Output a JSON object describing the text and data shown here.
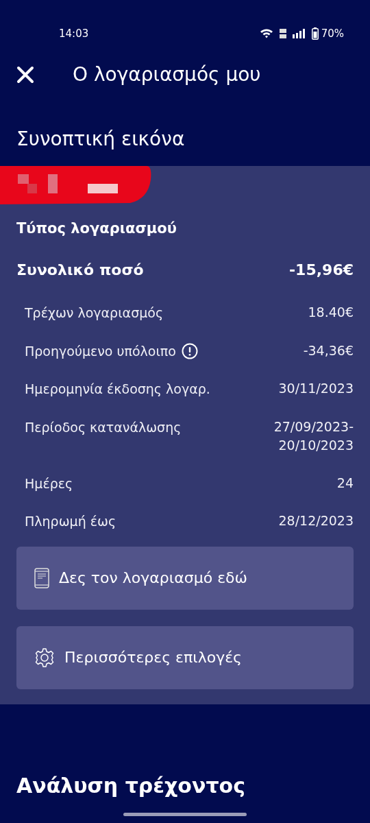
{
  "status_bar": {
    "time": "14:03",
    "battery": "70%"
  },
  "header": {
    "title": "Ο λογαριασμός μου"
  },
  "summary": {
    "title": "Συνοπτική εικόνα",
    "account_type": "Τύπος λογαριασμού",
    "total": {
      "label": "Συνολικό ποσό",
      "value": "-15,96€"
    },
    "rows": [
      {
        "label": "Τρέχων λογαριασμός",
        "value": "18.40€",
        "info": false
      },
      {
        "label": "Προηγούμενο υπόλοιπο",
        "value": "-34,36€",
        "info": true
      },
      {
        "label": "Ημερομηνία έκδοσης λογαρ.",
        "value": "30/11/2023",
        "info": false
      },
      {
        "label": "Περίοδος κατανάλωσης",
        "value": "27/09/2023-\n20/10/2023",
        "info": false
      },
      {
        "label": "Ημέρες",
        "value": "24",
        "info": false
      },
      {
        "label": "Πληρωμή έως",
        "value": "28/12/2023",
        "info": false
      }
    ],
    "buttons": [
      {
        "kind": "document",
        "label": "Δες τον λογαριασμό εδώ"
      },
      {
        "kind": "settings",
        "label": "Περισσότερες επιλογές"
      }
    ]
  },
  "next_section": {
    "title": "Ανάλυση τρέχοντος"
  }
}
